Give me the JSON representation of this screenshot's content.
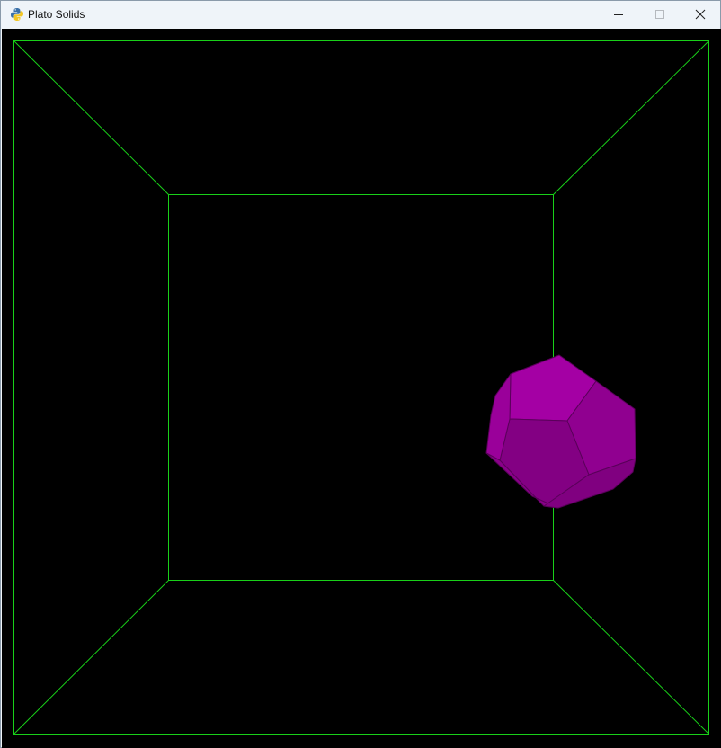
{
  "window": {
    "title": "Plato Solids"
  },
  "controls": {
    "minimize_icon": "minimize-icon",
    "maximize_icon": "maximize-icon",
    "close_icon": "close-icon"
  },
  "scene": {
    "background_color": "#000000",
    "wireframe_color": "#19d019",
    "solid": "dodecahedron",
    "solid_color": "#a400a4",
    "solid_edge_color": "#5a005a"
  }
}
